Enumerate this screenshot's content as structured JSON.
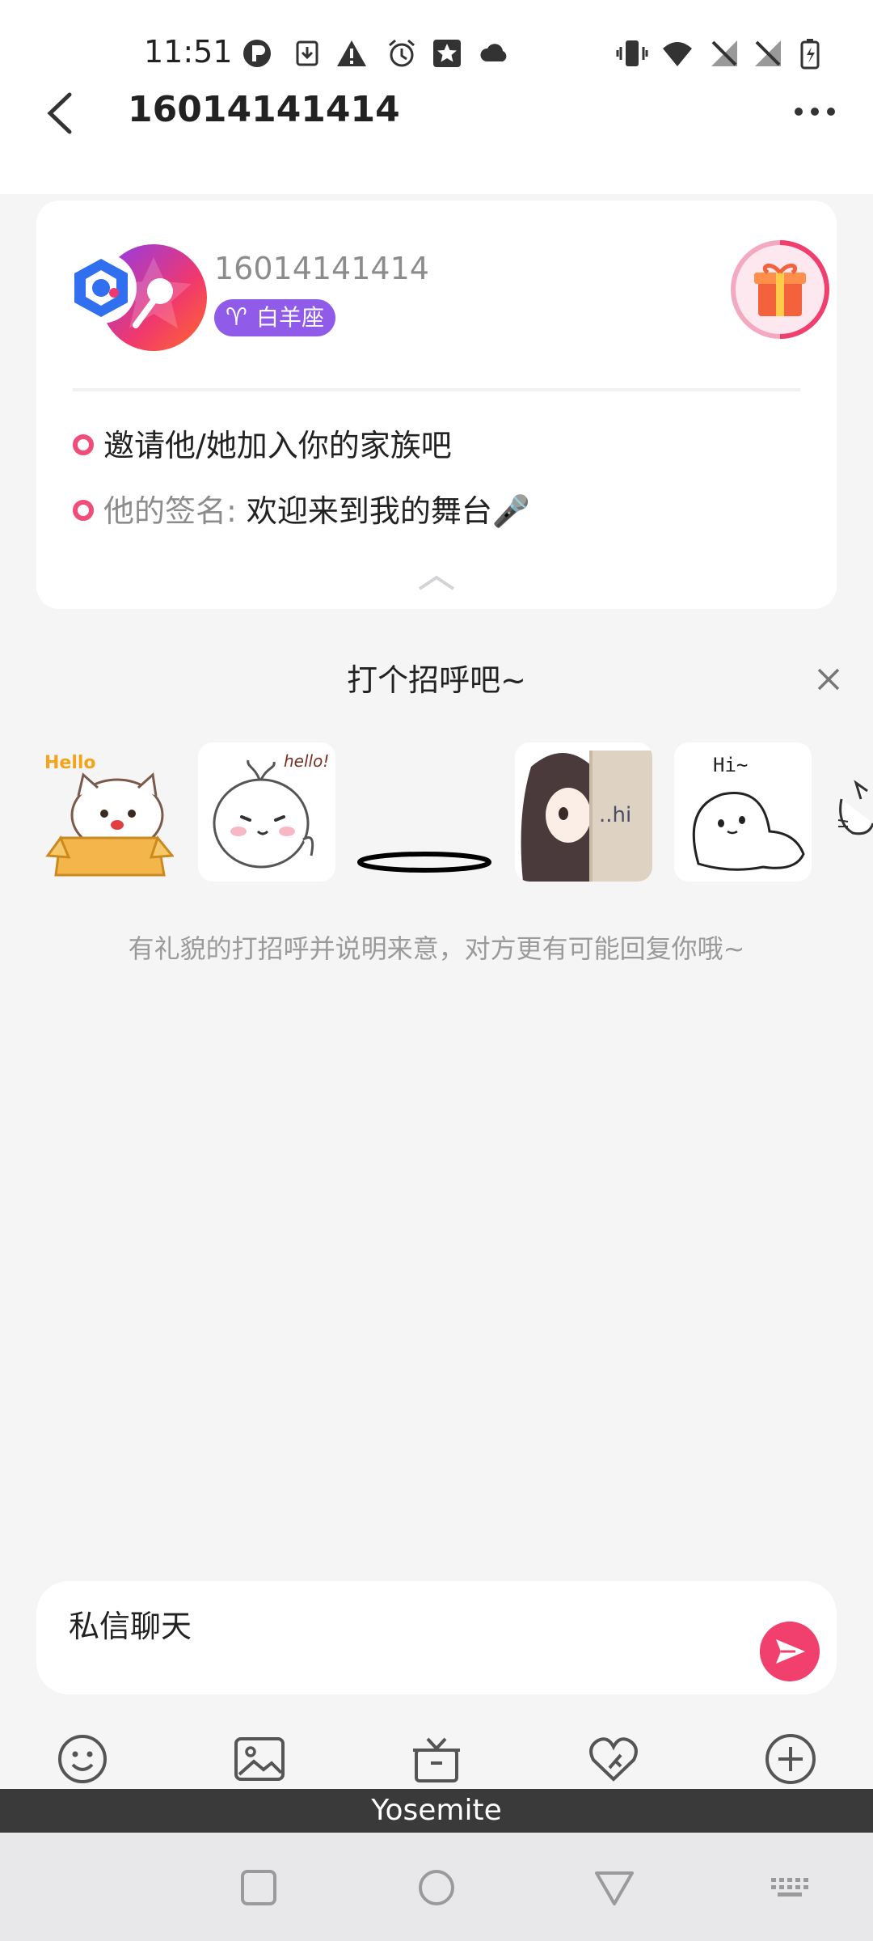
{
  "status_bar": {
    "time": "11:51",
    "left_icons": [
      "p-badge-icon",
      "download-icon",
      "warning-icon",
      "alarm-icon",
      "star-app-icon",
      "cloud-icon"
    ],
    "right_icons": [
      "vibrate-icon",
      "wifi-icon",
      "no-signal-icon",
      "no-signal-icon",
      "battery-charging-icon"
    ]
  },
  "header": {
    "title": "16014141414"
  },
  "profile": {
    "name": "16014141414",
    "zodiac_symbol": "♈",
    "zodiac": "白羊座",
    "invite_text": "邀请他/她加入你的家族吧",
    "signature_label": "他的签名:",
    "signature_text": "欢迎来到我的舞台🎤"
  },
  "greeting": {
    "title": "打个招呼吧~",
    "hint": "有礼貌的打招呼并说明来意，对方更有可能回复你哦~",
    "stickers": [
      {
        "name": "sticker-hello-cat",
        "caption": "Hello"
      },
      {
        "name": "sticker-hello-bun",
        "caption": "hello!"
      },
      {
        "name": "sticker-ring",
        "caption": ""
      },
      {
        "name": "sticker-hi-girl",
        "caption": "..hi"
      },
      {
        "name": "sticker-hi-seal",
        "caption": "Hi~"
      }
    ]
  },
  "input": {
    "placeholder": "私信聊天"
  },
  "toolbar": {
    "icons": [
      "emoji-icon",
      "image-icon",
      "gift-icon",
      "heart-key-icon",
      "plus-icon"
    ]
  },
  "system": {
    "device_label": "Yosemite"
  },
  "colors": {
    "accent_pink": "#f13f6e",
    "zodiac_purple": "#8f5be8",
    "background": "#f5f5f6"
  }
}
